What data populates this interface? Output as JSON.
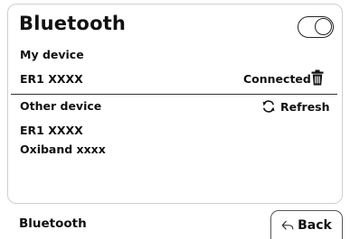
{
  "header": {
    "title": "Bluetooth",
    "toggle_state": "on"
  },
  "my_device": {
    "section_label": "My device",
    "device_name": "ER1 XXXX",
    "status": "Connected",
    "delete_icon": "trash-icon"
  },
  "other_device": {
    "section_label": "Other device",
    "refresh_label": "Refresh",
    "refresh_icon": "refresh-icon",
    "devices": [
      {
        "name": "ER1 XXXX"
      },
      {
        "name": "Oxiband xxxx"
      }
    ]
  },
  "footer": {
    "label": "Bluetooth",
    "back_label": "Back",
    "back_icon": "back-arrow-icon"
  }
}
